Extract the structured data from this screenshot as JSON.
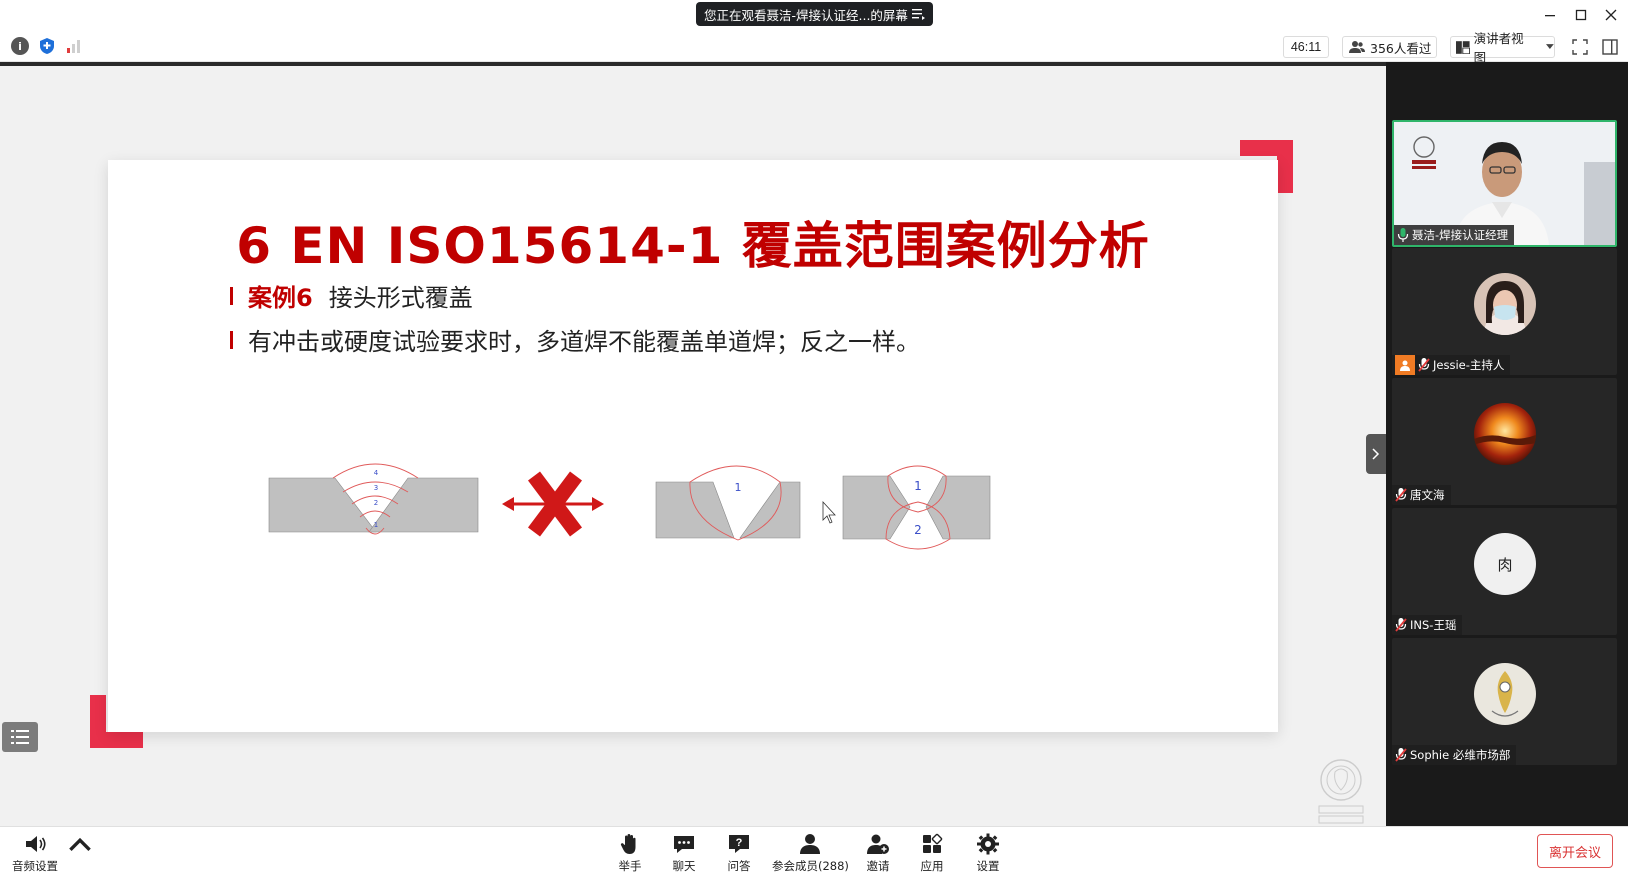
{
  "window": {
    "title": "您正在观看聂洁-焊接认证经...的屏幕",
    "controls": [
      "minimize",
      "maximize",
      "close"
    ]
  },
  "toolbar": {
    "timer": "46:11",
    "viewers": "356人看过",
    "view_mode": "演讲者视图"
  },
  "slide": {
    "title": "6 EN ISO15614-1 覆盖范围案例分析",
    "bullet1_tag": "案例6",
    "bullet1_text": "接头形式覆盖",
    "bullet2_text": "有冲击或硬度试验要求时，多道焊不能覆盖单道焊；反之一样。",
    "diagram_labels": {
      "multi_pass": [
        "4",
        "3",
        "2",
        "1"
      ],
      "single_v": "1",
      "double_v_top": "1",
      "double_v_bottom": "2"
    }
  },
  "participants": [
    {
      "name": "聂洁-焊接认证经理",
      "active": true,
      "host": false
    },
    {
      "name": "Jessie-主持人",
      "active": false,
      "host": true
    },
    {
      "name": "唐文海",
      "active": false,
      "host": false
    },
    {
      "name": "INS-王瑶",
      "active": false,
      "host": false,
      "avatar_char": "肉"
    },
    {
      "name": "Sophie 必维市场部",
      "active": false,
      "host": false
    }
  ],
  "bottombar": {
    "audio": "音频设置",
    "raise_hand": "举手",
    "chat": "聊天",
    "qa": "问答",
    "members": "参会成员(288)",
    "invite": "邀请",
    "apps": "应用",
    "settings": "设置",
    "leave": "离开会议"
  },
  "colors": {
    "accent_red": "#c00000",
    "corner_red": "#e8304a",
    "active_green": "#2fb56a",
    "panel_dark": "#1a1a1a"
  }
}
